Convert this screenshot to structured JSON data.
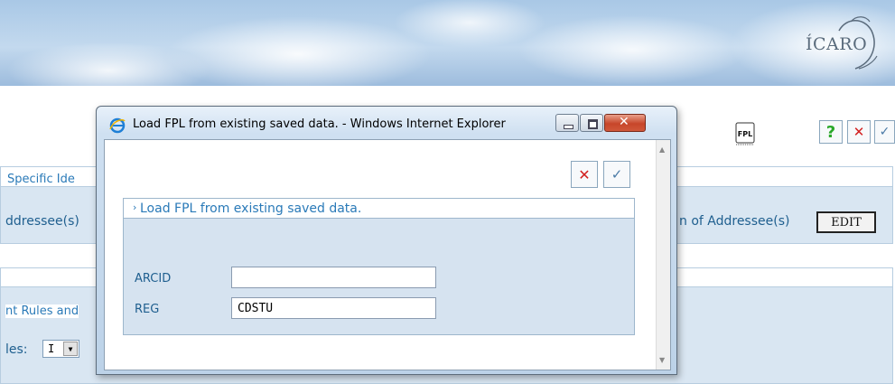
{
  "banner": {
    "logo_text": "ÍCARO"
  },
  "toolbar": {
    "help": "?",
    "close": "✕",
    "confirm": "✓",
    "fpl": "FPL"
  },
  "background": {
    "specific_ide": "Specific Ide",
    "addressees_left": "ddressee(s)",
    "addressees_right": "n of Addressee(s)",
    "edit_button": "EDIT",
    "rules_section": "nt Rules and",
    "rules_label": "les:",
    "rules_value": "I"
  },
  "popup": {
    "title": "Load FPL from existing saved data. - Windows Internet Explorer",
    "form_title": "Load FPL from existing saved data.",
    "fields": [
      {
        "label": "ARCID",
        "value": ""
      },
      {
        "label": "REG",
        "value": "CDSTU"
      }
    ]
  },
  "colors": {
    "accent": "#2a7ab8",
    "label": "#1f5f8f",
    "cancel": "#d22020",
    "help": "#2aa82a"
  }
}
